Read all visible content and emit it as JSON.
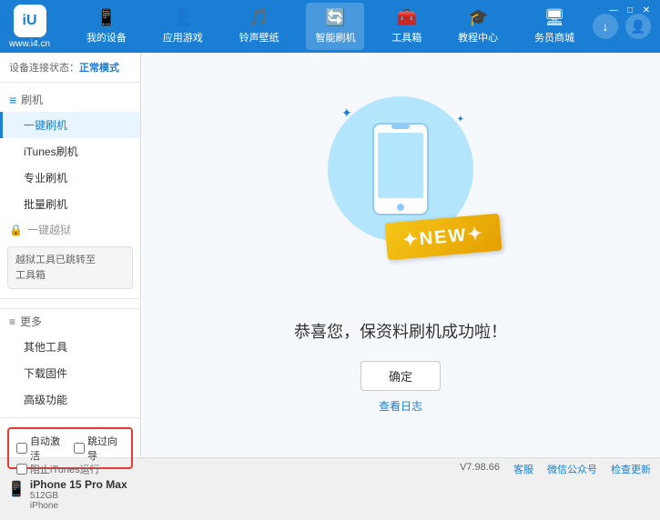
{
  "app": {
    "logo_text": "www.i4.cn",
    "logo_icon": "iU"
  },
  "nav": {
    "items": [
      {
        "id": "my-device",
        "label": "我的设备",
        "icon": "📱"
      },
      {
        "id": "app-games",
        "label": "应用游戏",
        "icon": "👤"
      },
      {
        "id": "ringtone",
        "label": "铃声壁纸",
        "icon": "🎵"
      },
      {
        "id": "smart-flash",
        "label": "智能刷机",
        "icon": "🔄",
        "active": true
      },
      {
        "id": "toolbox",
        "label": "工具箱",
        "icon": "🧰"
      },
      {
        "id": "tutorial",
        "label": "教程中心",
        "icon": "🎓"
      },
      {
        "id": "service",
        "label": "务员商城",
        "icon": "🖥"
      }
    ]
  },
  "sidebar": {
    "status_label": "设备连接状态：",
    "status_value": "正常模式",
    "section_flash": "刷机",
    "items": [
      {
        "id": "one-click-flash",
        "label": "一键刷机",
        "active": true
      },
      {
        "id": "itunes-flash",
        "label": "iTunes刷机"
      },
      {
        "id": "pro-flash",
        "label": "专业刷机"
      },
      {
        "id": "batch-flash",
        "label": "批量刷机"
      }
    ],
    "disabled_label": "一键越狱",
    "info_box": "越狱工具已跳转至\n工具箱",
    "more_label": "更多",
    "more_items": [
      {
        "id": "other-tools",
        "label": "其他工具"
      },
      {
        "id": "download-firmware",
        "label": "下载固件"
      },
      {
        "id": "advanced",
        "label": "高级功能"
      }
    ],
    "checkbox_auto": "自动激活",
    "checkbox_guide": "跳过向导",
    "device_name": "iPhone 15 Pro Max",
    "device_storage": "512GB",
    "device_type": "iPhone",
    "stop_itunes": "阻止iTunes运行"
  },
  "content": {
    "success_message": "恭喜您，保资料刷机成功啦！",
    "confirm_btn": "确定",
    "log_link": "查看日志"
  },
  "bottom": {
    "version": "V7.98.66",
    "links": [
      "客服",
      "微信公众号",
      "检查更新"
    ]
  },
  "win_controls": [
    "🗕",
    "🗗",
    "✕"
  ]
}
